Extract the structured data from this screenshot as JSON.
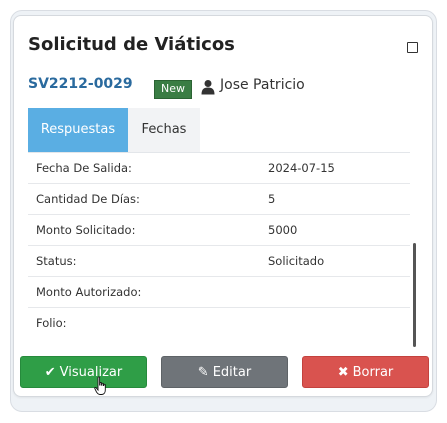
{
  "card": {
    "title": "Solicitud de Viáticos",
    "code": "SV2212-0029",
    "badge": "New",
    "user": "Jose Patricio"
  },
  "tabs": [
    {
      "label": "Respuestas",
      "active": true
    },
    {
      "label": "Fechas",
      "active": false
    }
  ],
  "fields": [
    {
      "label": "Fecha De Salida:",
      "value": "2024-07-15"
    },
    {
      "label": "Cantidad De Días:",
      "value": "5"
    },
    {
      "label": "Monto Solicitado:",
      "value": "5000"
    },
    {
      "label": "Status:",
      "value": "Solicitado"
    },
    {
      "label": "Monto Autorizado:",
      "value": ""
    },
    {
      "label": "Folio:",
      "value": ""
    }
  ],
  "actions": {
    "view_label": "Visualizar",
    "edit_label": "Editar",
    "delete_label": "Borrar"
  },
  "icons": {
    "maximize": "square-outline-icon",
    "user": "user-icon",
    "check": "check-icon",
    "pencil": "pencil-icon",
    "close": "x-icon"
  },
  "colors": {
    "accent": "#5aaee3",
    "link": "#2a6a9e",
    "badge": "#3a7d44",
    "success": "#2f9e47",
    "secondary": "#6f7479",
    "danger": "#d9534f"
  }
}
